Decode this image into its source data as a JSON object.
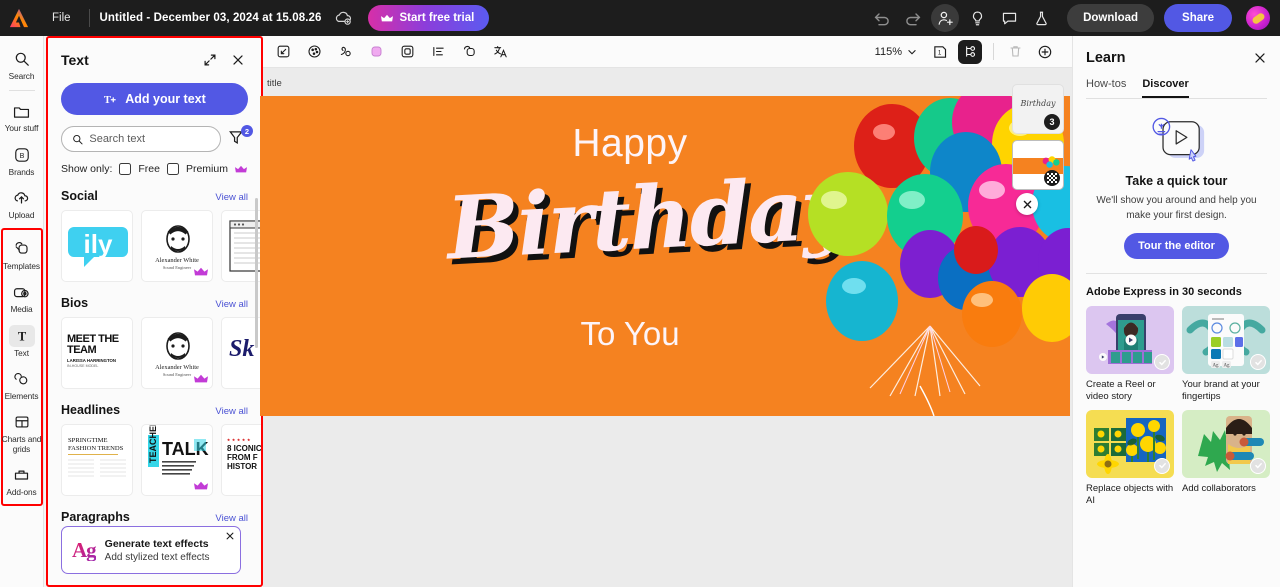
{
  "topbar": {
    "logo_icon": "adobe-express-logo",
    "file_menu": "File",
    "doc_title": "Untitled - December 03, 2024 at 15.08.26",
    "cloud_icon": "cloud-sync-icon",
    "trial_label": "Start free trial",
    "crown_icon": "crown-icon",
    "undo_icon": "undo-icon",
    "redo_icon": "redo-icon",
    "invite_icon": "add-person-icon",
    "ideas_icon": "lightbulb-icon",
    "comment_icon": "comment-icon",
    "beta_icon": "flask-icon",
    "download_label": "Download",
    "share_label": "Share",
    "avatar_icon": "user-avatar"
  },
  "rail": {
    "items": [
      {
        "label": "Search",
        "icon": "search-icon"
      },
      {
        "label": "Your stuff",
        "icon": "folder-icon"
      },
      {
        "label": "Brands",
        "icon": "brand-b-icon"
      },
      {
        "label": "Upload",
        "icon": "upload-cloud-icon"
      }
    ],
    "grouped_items": [
      {
        "label": "Templates",
        "icon": "templates-icon"
      },
      {
        "label": "Media",
        "icon": "media-camera-icon"
      },
      {
        "label": "Text",
        "icon": "text-t-icon"
      },
      {
        "label": "Elements",
        "icon": "elements-shapes-icon"
      },
      {
        "label": "Charts and grids",
        "icon": "charts-grid-icon"
      },
      {
        "label": "Add-ons",
        "icon": "addons-icon"
      }
    ],
    "active": "Text"
  },
  "text_panel": {
    "title": "Text",
    "expand_icon": "expand-diagonal-icon",
    "close_icon": "close-icon",
    "add_text_label": "Add your text",
    "add_text_icon": "add-text-icon",
    "search_placeholder": "Search text",
    "search_value": "",
    "search_icon": "search-icon",
    "filter_icon": "filter-funnel-icon",
    "filter_count": "2",
    "show_only_label": "Show only:",
    "free_label": "Free",
    "premium_label": "Premium",
    "premium_icon": "crown-icon",
    "view_all_label": "View all",
    "sections": [
      {
        "title": "Social",
        "thumbs": [
          {
            "name": "ily-speech-bubble-template",
            "premium": false
          },
          {
            "name": "alexander-white-bio-template",
            "premium": true,
            "line1": "Alexander White",
            "line2": "Sound Engineer"
          },
          {
            "name": "get-template",
            "premium": false
          }
        ]
      },
      {
        "title": "Bios",
        "thumbs": [
          {
            "name": "meet-the-team-template",
            "premium": false,
            "line1": "MEET THE",
            "line2": "TEAM",
            "line3": "LARISSA HARRINGTON",
            "line4": "IN-HOUSE MODEL"
          },
          {
            "name": "alexander-white-bio-template",
            "premium": true,
            "line1": "Alexander White",
            "line2": "Sound Engineer"
          },
          {
            "name": "sk-script-template",
            "premium": false,
            "line1": "Sk"
          }
        ]
      },
      {
        "title": "Headlines",
        "thumbs": [
          {
            "name": "springtime-fashion-trends-template",
            "premium": false,
            "line1": "SPRINGTIME",
            "line2": "FASHION TRENDS"
          },
          {
            "name": "teacher-talk-template",
            "premium": true,
            "line1": "TEACHER",
            "line2": "TALK"
          },
          {
            "name": "iconic-from-history-template",
            "premium": false,
            "line1": "8 ICONIC",
            "line2": "FROM F",
            "line3": "HISTOR"
          }
        ]
      },
      {
        "title": "Paragraphs",
        "thumbs": []
      }
    ],
    "promo": {
      "badge": "Ag",
      "title": "Generate text effects",
      "subtitle": "Add stylized text effects",
      "close_icon": "close-icon"
    }
  },
  "canvas_toolbar": {
    "buttons": [
      {
        "name": "resize-icon"
      },
      {
        "name": "theme-palette-icon"
      },
      {
        "name": "animation-icon"
      },
      {
        "name": "shape-fill-icon"
      },
      {
        "name": "frame-icon"
      },
      {
        "name": "align-list-icon"
      },
      {
        "name": "group-layers-icon"
      },
      {
        "name": "translate-icon"
      }
    ],
    "zoom_level": "115%",
    "zoom_caret_icon": "chevron-down-icon",
    "page_count_icon": "page-one-icon",
    "layers_icon": "layers-icon",
    "delete_icon": "trash-icon",
    "add_page_icon": "add-circle-icon"
  },
  "canvas": {
    "page_title_text": "title",
    "close_icon": "close-icon",
    "design": {
      "line1": "Happy",
      "line2": "Birthday",
      "line3": "To You",
      "background_color": "#f58220",
      "script_color": "#fce9f1",
      "shadow_color": "#111111",
      "image_alt": "colorful balloons bunch"
    },
    "page_thumbs": [
      {
        "name": "page-thumb-1",
        "badge": "3",
        "script": "Birthday"
      },
      {
        "name": "page-thumb-2",
        "badge": "",
        "selected": true
      }
    ]
  },
  "learn": {
    "title": "Learn",
    "close_icon": "close-icon",
    "tabs": [
      {
        "label": "How-tos",
        "active": false
      },
      {
        "label": "Discover",
        "active": true
      }
    ],
    "illustration_icon": "lightbulb-play-video-icon",
    "tour_heading": "Take a quick tour",
    "tour_body": "We'll show you around and help you make your first design.",
    "tour_button": "Tour the editor",
    "section_title": "Adobe Express in 30 seconds",
    "cards": [
      {
        "label": "Create a Reel or video story",
        "name": "card-create-reel",
        "bg": "#dcc6f0",
        "check_icon": "check-circle-icon"
      },
      {
        "label": "Your brand at your fingertips",
        "name": "card-your-brand",
        "bg": "#bcdedb",
        "check_icon": "check-circle-icon"
      },
      {
        "label": "Replace objects with AI",
        "name": "card-replace-objects",
        "bg": "#f5dd52",
        "check_icon": "check-circle-icon"
      },
      {
        "label": "Add collaborators",
        "name": "card-add-collaborators",
        "bg": "#d5edc4",
        "check_icon": "check-circle-icon"
      }
    ]
  },
  "colors": {
    "accent": "#5258e4",
    "topbar_bg": "#1d1d1d",
    "canvas_bg": "#f58220",
    "highlight_outline": "#ff0000"
  }
}
